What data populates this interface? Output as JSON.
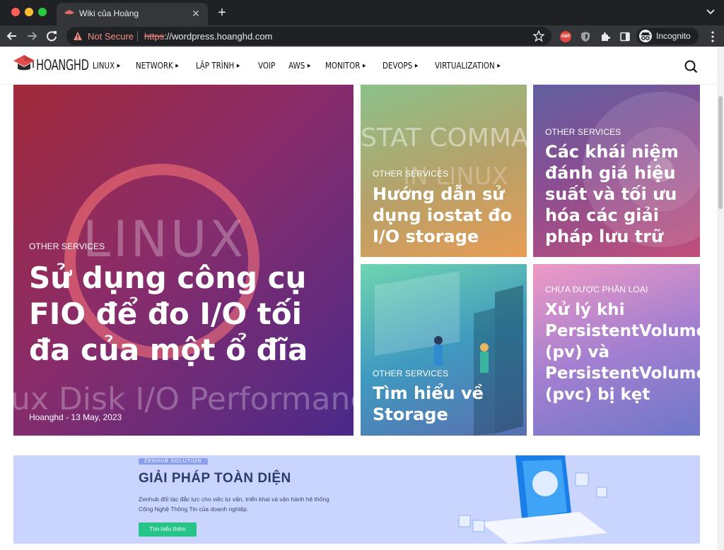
{
  "browser": {
    "tab_title": "Wiki của Hoàng",
    "security_label": "Not Secure",
    "url_scheme": "https",
    "url_rest": "://wordpress.hoanghd.com",
    "extension_abp": "ABP",
    "profile_label": "Incognito"
  },
  "site": {
    "logo_text": "HOANGHD",
    "menu": [
      {
        "label": "LINUX",
        "has_caret": true
      },
      {
        "label": "NETWORK",
        "has_caret": true
      },
      {
        "label": "LẬP TRÌNH",
        "has_caret": true
      },
      {
        "label": "VOIP",
        "has_caret": false
      },
      {
        "label": "AWS",
        "has_caret": true
      },
      {
        "label": "MONITOR",
        "has_caret": true
      },
      {
        "label": "DEVOPS",
        "has_caret": true
      },
      {
        "label": "VIRTUALIZATION",
        "has_caret": true
      }
    ],
    "featured": {
      "category": "OTHER SERVICES",
      "title": "Sử dụng công cụ FIO để đo I/O tối đa của một ổ đĩa",
      "author": "Hoanghd",
      "date": "13 May, 2023",
      "watermark_top": "LINUX",
      "watermark_bottom": "ux Disk I/O Performanc"
    },
    "posts": [
      {
        "category": "OTHER SERVICES",
        "title": "Hướng dẫn sử dụng iostat đo I/O storage",
        "watermark": "STAT COMMAN",
        "watermark2": "IN LINUX"
      },
      {
        "category": "OTHER SERVICES",
        "title": "Các khái niệm đánh giá hiệu suất và tối ưu hóa các giải pháp lưu trữ"
      },
      {
        "category": "OTHER SERVICES",
        "title": "Tìm hiểu về Storage"
      },
      {
        "category": "CHƯA ĐƯỢC PHÂN LOẠI",
        "title": "Xử lý khi PersistentVolume (pv) và PersistentVolumeClaim (pvc) bị kẹt"
      }
    ],
    "banner": {
      "tag": "ZENHUB SOLUTION",
      "title": "GIẢI PHÁP TOÀN DIỆN",
      "description": "Zenhub đối tác đắc lực cho việc tư vấn, triển khai và vận hành hệ thống Công Nghệ Thông Tin của doanh nghiệp.",
      "button": "Tìm hiểu thêm"
    }
  }
}
